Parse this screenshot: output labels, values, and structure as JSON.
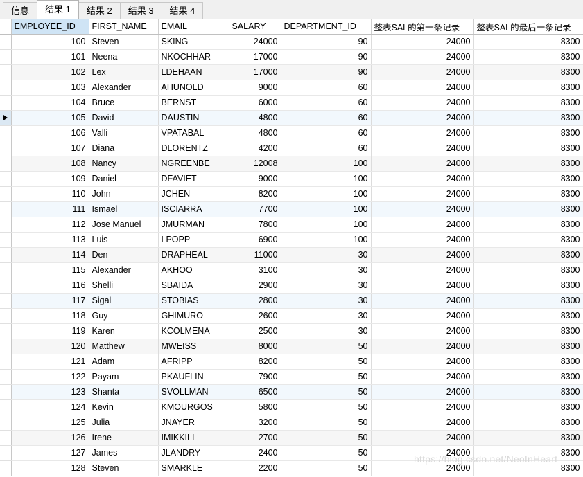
{
  "tabs": [
    {
      "label": "信息",
      "active": false
    },
    {
      "label": "结果 1",
      "active": true
    },
    {
      "label": "结果 2",
      "active": false
    },
    {
      "label": "结果 3",
      "active": false
    },
    {
      "label": "结果 4",
      "active": false
    }
  ],
  "grid": {
    "columns": [
      {
        "label": "EMPLOYEE_ID",
        "align": "num",
        "selected": true
      },
      {
        "label": "FIRST_NAME",
        "align": "txt",
        "selected": false
      },
      {
        "label": "EMAIL",
        "align": "txt",
        "selected": false
      },
      {
        "label": "SALARY",
        "align": "num",
        "selected": false
      },
      {
        "label": "DEPARTMENT_ID",
        "align": "num",
        "selected": false
      },
      {
        "label": "整表SAL的第一条记录",
        "align": "num",
        "selected": false
      },
      {
        "label": "整表SAL的最后一条记录",
        "align": "num",
        "selected": false
      }
    ],
    "rows": [
      {
        "cells": [
          "100",
          "Steven",
          "SKING",
          "24000",
          "90",
          "24000",
          "8300"
        ],
        "style": "r-white",
        "marked": false
      },
      {
        "cells": [
          "101",
          "Neena",
          "NKOCHHAR",
          "17000",
          "90",
          "24000",
          "8300"
        ],
        "style": "r-white",
        "marked": false
      },
      {
        "cells": [
          "102",
          "Lex",
          "LDEHAAN",
          "17000",
          "90",
          "24000",
          "8300"
        ],
        "style": "r-gray",
        "marked": false
      },
      {
        "cells": [
          "103",
          "Alexander",
          "AHUNOLD",
          "9000",
          "60",
          "24000",
          "8300"
        ],
        "style": "r-white",
        "marked": false
      },
      {
        "cells": [
          "104",
          "Bruce",
          "BERNST",
          "6000",
          "60",
          "24000",
          "8300"
        ],
        "style": "r-white",
        "marked": false
      },
      {
        "cells": [
          "105",
          "David",
          "DAUSTIN",
          "4800",
          "60",
          "24000",
          "8300"
        ],
        "style": "r-blue",
        "marked": true
      },
      {
        "cells": [
          "106",
          "Valli",
          "VPATABAL",
          "4800",
          "60",
          "24000",
          "8300"
        ],
        "style": "r-white",
        "marked": false
      },
      {
        "cells": [
          "107",
          "Diana",
          "DLORENTZ",
          "4200",
          "60",
          "24000",
          "8300"
        ],
        "style": "r-white",
        "marked": false
      },
      {
        "cells": [
          "108",
          "Nancy",
          "NGREENBE",
          "12008",
          "100",
          "24000",
          "8300"
        ],
        "style": "r-gray",
        "marked": false
      },
      {
        "cells": [
          "109",
          "Daniel",
          "DFAVIET",
          "9000",
          "100",
          "24000",
          "8300"
        ],
        "style": "r-white",
        "marked": false
      },
      {
        "cells": [
          "110",
          "John",
          "JCHEN",
          "8200",
          "100",
          "24000",
          "8300"
        ],
        "style": "r-white",
        "marked": false
      },
      {
        "cells": [
          "111",
          "Ismael",
          "ISCIARRA",
          "7700",
          "100",
          "24000",
          "8300"
        ],
        "style": "r-blue",
        "marked": false
      },
      {
        "cells": [
          "112",
          "Jose Manuel",
          "JMURMAN",
          "7800",
          "100",
          "24000",
          "8300"
        ],
        "style": "r-white",
        "marked": false
      },
      {
        "cells": [
          "113",
          "Luis",
          "LPOPP",
          "6900",
          "100",
          "24000",
          "8300"
        ],
        "style": "r-white",
        "marked": false
      },
      {
        "cells": [
          "114",
          "Den",
          "DRAPHEAL",
          "11000",
          "30",
          "24000",
          "8300"
        ],
        "style": "r-gray",
        "marked": false
      },
      {
        "cells": [
          "115",
          "Alexander",
          "AKHOO",
          "3100",
          "30",
          "24000",
          "8300"
        ],
        "style": "r-white",
        "marked": false
      },
      {
        "cells": [
          "116",
          "Shelli",
          "SBAIDA",
          "2900",
          "30",
          "24000",
          "8300"
        ],
        "style": "r-white",
        "marked": false
      },
      {
        "cells": [
          "117",
          "Sigal",
          "STOBIAS",
          "2800",
          "30",
          "24000",
          "8300"
        ],
        "style": "r-blue",
        "marked": false
      },
      {
        "cells": [
          "118",
          "Guy",
          "GHIMURO",
          "2600",
          "30",
          "24000",
          "8300"
        ],
        "style": "r-white",
        "marked": false
      },
      {
        "cells": [
          "119",
          "Karen",
          "KCOLMENA",
          "2500",
          "30",
          "24000",
          "8300"
        ],
        "style": "r-white",
        "marked": false
      },
      {
        "cells": [
          "120",
          "Matthew",
          "MWEISS",
          "8000",
          "50",
          "24000",
          "8300"
        ],
        "style": "r-gray",
        "marked": false
      },
      {
        "cells": [
          "121",
          "Adam",
          "AFRIPP",
          "8200",
          "50",
          "24000",
          "8300"
        ],
        "style": "r-white",
        "marked": false
      },
      {
        "cells": [
          "122",
          "Payam",
          "PKAUFLIN",
          "7900",
          "50",
          "24000",
          "8300"
        ],
        "style": "r-white",
        "marked": false
      },
      {
        "cells": [
          "123",
          "Shanta",
          "SVOLLMAN",
          "6500",
          "50",
          "24000",
          "8300"
        ],
        "style": "r-blue",
        "marked": false
      },
      {
        "cells": [
          "124",
          "Kevin",
          "KMOURGOS",
          "5800",
          "50",
          "24000",
          "8300"
        ],
        "style": "r-white",
        "marked": false
      },
      {
        "cells": [
          "125",
          "Julia",
          "JNAYER",
          "3200",
          "50",
          "24000",
          "8300"
        ],
        "style": "r-white",
        "marked": false
      },
      {
        "cells": [
          "126",
          "Irene",
          "IMIKKILI",
          "2700",
          "50",
          "24000",
          "8300"
        ],
        "style": "r-gray",
        "marked": false
      },
      {
        "cells": [
          "127",
          "James",
          "JLANDRY",
          "2400",
          "50",
          "24000",
          "8300"
        ],
        "style": "r-white",
        "marked": false
      },
      {
        "cells": [
          "128",
          "Steven",
          "SMARKLE",
          "2200",
          "50",
          "24000",
          "8300"
        ],
        "style": "r-white",
        "marked": false
      }
    ]
  },
  "watermark": {
    "text": "https://blog.csdn.net/NeoInHeart"
  }
}
